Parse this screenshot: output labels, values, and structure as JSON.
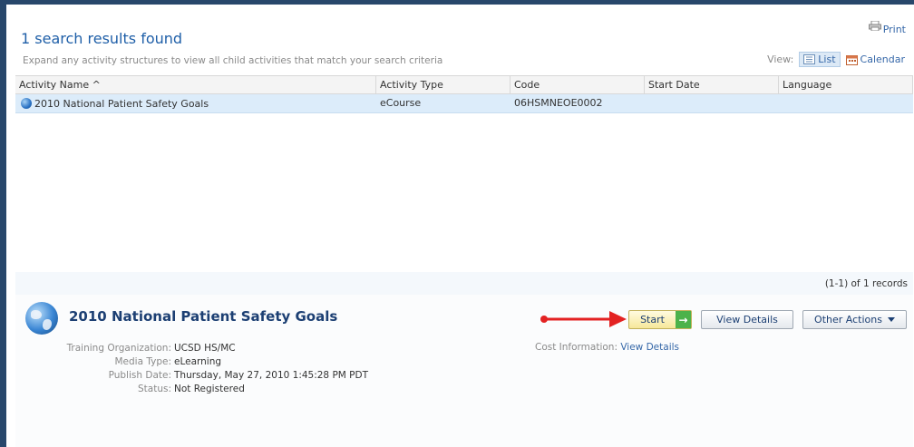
{
  "header": {
    "title": "1 search results found",
    "subtitle": "Expand any activity structures to view all child activities that match your search criteria",
    "print_label": "Print",
    "view_label": "View:",
    "view_list": "List",
    "view_calendar": "Calendar"
  },
  "table": {
    "columns": [
      "Activity Name ^",
      "Activity Type",
      "Code",
      "Start Date",
      "Language"
    ],
    "rows": [
      {
        "name": "2010 National Patient Safety Goals",
        "type": "eCourse",
        "code": "06HSMNEOE0002",
        "start_date": "",
        "language": ""
      }
    ]
  },
  "pager": {
    "text": "(1-1) of 1 records"
  },
  "detail": {
    "title": "2010 National Patient Safety Goals",
    "fields": [
      {
        "label": "Training Organization:",
        "value": "UCSD HS/MC"
      },
      {
        "label": "Media Type:",
        "value": "eLearning"
      },
      {
        "label": "Publish Date:",
        "value": "Thursday, May 27, 2010 1:45:28 PM PDT"
      },
      {
        "label": "Status:",
        "value": "Not Registered"
      }
    ],
    "cost_label": "Cost Information:",
    "cost_link": "View Details",
    "start_button": "Start",
    "details_button": "View Details",
    "other_actions_button": "Other Actions"
  },
  "colors": {
    "frame": "#28476b",
    "link": "#3567a8",
    "selected_row": "#dcecfa",
    "annotation_arrow": "#e32222",
    "start_arrow": "#4cb24a"
  },
  "icons": [
    "printer-icon",
    "list-view-icon",
    "calendar-icon",
    "globe-icon",
    "arrow-right-icon",
    "caret-down-icon",
    "annotation-arrow"
  ]
}
